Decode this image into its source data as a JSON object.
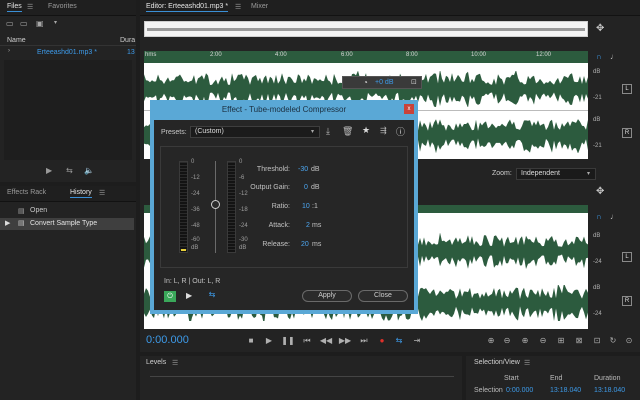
{
  "files_panel": {
    "tabs": [
      "Files",
      "Favorites"
    ],
    "col_name": "Name",
    "col_duration": "Dura",
    "file_name": "Erteeashd01.mp3 *",
    "file_duration": "13"
  },
  "history_panel": {
    "tabs": [
      "Effects Rack",
      "History"
    ],
    "items": [
      "Open",
      "Convert Sample Type"
    ]
  },
  "editor": {
    "tab_label": "Editor: Erteeashd01.mp3 *",
    "mixer_label": "Mixer",
    "ruler_labels": [
      "hms",
      "2:00",
      "4:00",
      "6:00",
      "8:00",
      "10:00",
      "12:00"
    ],
    "db_top_ch1": [
      "dB",
      "-21",
      "dB",
      "-21"
    ],
    "db_bottom_ch": [
      "dB",
      "-24",
      "dB",
      "-24"
    ],
    "channel_left": "L",
    "channel_right": "R",
    "hud_gain": "+0 dB",
    "zoom_label": "Zoom:",
    "zoom_value": "Independent",
    "time": "0:00.000"
  },
  "dialog": {
    "title": "Effect - Tube-modeled Compressor",
    "presets_label": "Presets:",
    "presets_value": "(Custom)",
    "meter_scale": [
      "0",
      "-12",
      "-24",
      "-36",
      "-48",
      "-60",
      "dB"
    ],
    "gr_scale": [
      "0",
      "-6",
      "-12",
      "-18",
      "-24",
      "-30",
      "dB"
    ],
    "params": [
      {
        "label": "Threshold:",
        "value": "-30",
        "unit": "dB"
      },
      {
        "label": "Output Gain:",
        "value": "0",
        "unit": "dB"
      },
      {
        "label": "Ratio:",
        "value": "10",
        "unit": ":1"
      },
      {
        "label": "Attack:",
        "value": "2",
        "unit": "ms"
      },
      {
        "label": "Release:",
        "value": "20",
        "unit": "ms"
      }
    ],
    "io_label": "In: L, R | Out: L, R",
    "apply_label": "Apply",
    "close_label": "Close"
  },
  "levels": {
    "title": "Levels"
  },
  "selection": {
    "title": "Selection/View",
    "col_start": "Start",
    "col_end": "End",
    "col_duration": "Duration",
    "row_label": "Selection",
    "start": "0:00.000",
    "end": "13:18.040",
    "duration": "13:18.040"
  }
}
